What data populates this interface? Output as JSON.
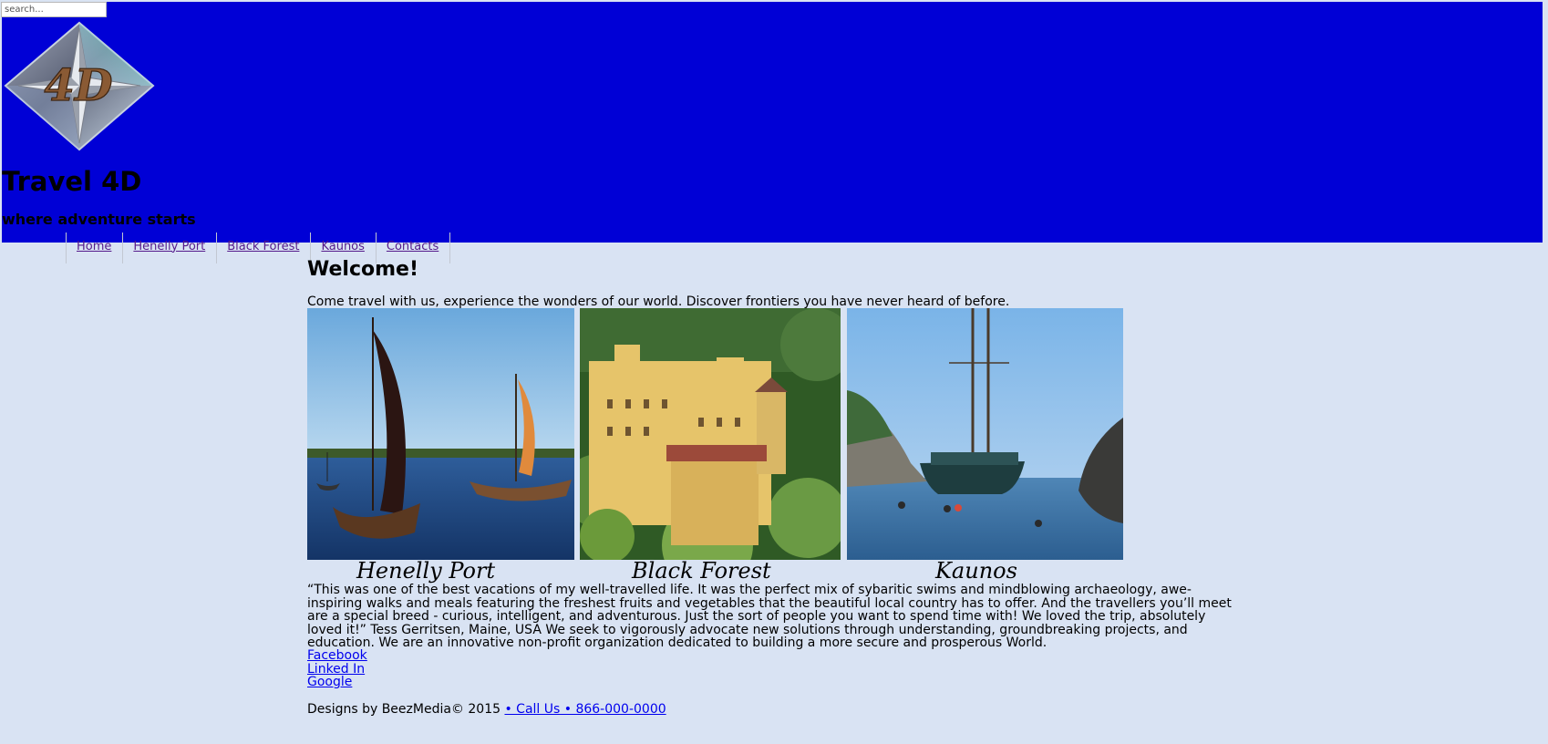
{
  "header": {
    "search_placeholder": "search...",
    "logo_text": "4D",
    "title": "Travel 4D",
    "tagline": "where adventure starts",
    "background": "#0000d6"
  },
  "nav": {
    "items": [
      {
        "label": "Home"
      },
      {
        "label": "Henelly Port"
      },
      {
        "label": "Black Forest"
      },
      {
        "label": "Kaunos"
      },
      {
        "label": "Contacts"
      }
    ]
  },
  "main": {
    "heading": "Welcome!",
    "intro": "Come travel with us, experience the wonders of our world. Discover frontiers you have never heard of before.",
    "gallery": [
      {
        "caption": "Henelly Port"
      },
      {
        "caption": "Black Forest"
      },
      {
        "caption": "Kaunos"
      }
    ],
    "quote": "“This was one of the best vacations of my well-travelled life. It was the perfect mix of sybaritic swims and mindblowing archaeology, awe-inspiring walks and meals featuring the freshest fruits and vegetables that the beautiful local country has to offer. And the travellers you’ll meet are a special breed - curious, intelligent, and adventurous. Just the sort of people you want to spend time with! We loved the trip, absolutely loved it!” Tess Gerritsen, Maine, USA We seek to vigorously advocate new solutions through understanding, groundbreaking projects, and education. We are an innovative non-profit organization dedicated to building a more secure and prosperous World.",
    "social_links": [
      {
        "label": "Facebook"
      },
      {
        "label": "Linked In"
      },
      {
        "label": "Google"
      }
    ]
  },
  "footer": {
    "credit": "Designs by BeezMedia© 2015",
    "call_link": "• Call Us • 866-000-0000"
  }
}
